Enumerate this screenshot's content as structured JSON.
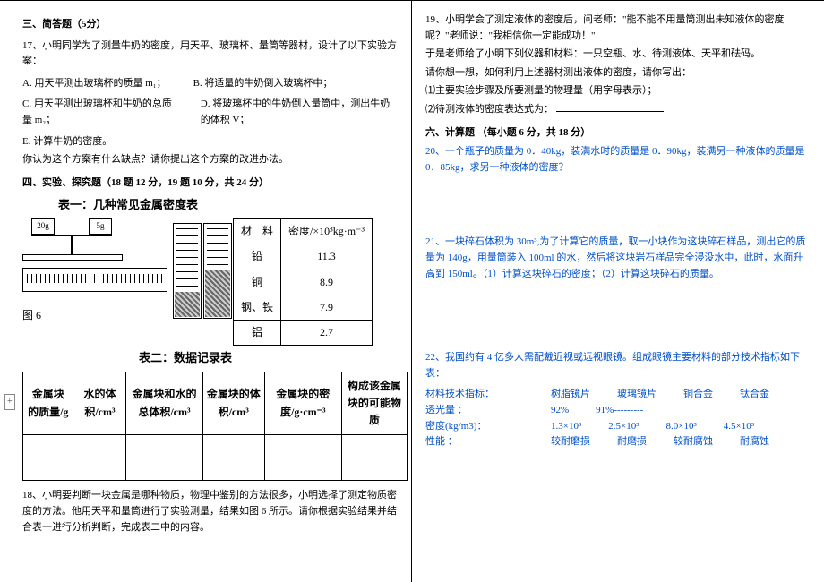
{
  "left": {
    "section3_title": "三、简答题（5分）",
    "q17_intro": "17、小明同学为了测量牛奶的密度，用天平、玻璃杯、量筒等器材，设计了以下实验方案：",
    "q17_A": "A. 用天平测出玻璃杯的质量 m₁；",
    "q17_B": "B. 将适量的牛奶倒入玻璃杯中；",
    "q17_C": "C. 用天平测出玻璃杯和牛奶的总质量 m₂；",
    "q17_D": "D. 将玻璃杯中的牛奶倒入量筒中，测出牛奶的体积 V；",
    "q17_E": "E. 计算牛奶的密度。",
    "q17_ask": "你认为这个方案有什么缺点？请你提出这个方案的改进办法。",
    "section4_title": "四、实验、探究题（18 题 12 分，19 题 10 分，共 24 分）",
    "table1_caption": "表一：几种常见金属密度表",
    "dens_header_mat": "材　料",
    "dens_header_rho": "密度/×10³kg·m⁻³",
    "dens_rows": [
      {
        "mat": "铅",
        "rho": "11.3"
      },
      {
        "mat": "铜",
        "rho": "8.9"
      },
      {
        "mat": "钢、铁",
        "rho": "7.9"
      },
      {
        "mat": "铝",
        "rho": "2.7"
      }
    ],
    "pan_left": "20g",
    "pan_right": "5g",
    "fig_label": "图 6",
    "table2_caption": "表二：数据记录表",
    "rec_headers": [
      "金属块的质量/g",
      "水的体积/cm³",
      "金属块和水的总体积/cm³",
      "金属块的体积/cm³",
      "金属块的密度/g·cm⁻³",
      "构成该金属块的可能物质"
    ],
    "q18": "18、小明要判断一块金属是哪种物质，物理中鉴别的方法很多，小明选择了测定物质密度的方法。他用天平和量筒进行了实验测量，结果如图 6 所示。请你根据实验结果并结合表一进行分析判断，完成表二中的内容。"
  },
  "right": {
    "q19_intro": "19、小明学会了测定液体的密度后，问老师：\"能不能不用量筒测出未知液体的密度呢？\"老师说：\"我相信你一定能成功！\"",
    "q19_given": "于是老师给了小明下列仪器和材料：一只空瓶、水、待测液体、天平和砝码。",
    "q19_ask": "请你想一想，如何利用上述器材测出液体的密度，请你写出：",
    "q19_sub1": "⑴主要实验步骤及所要测量的物理量（用字母表示）；",
    "q19_sub2_pre": "⑵待测液体的密度表达式为：",
    "section6_title": "六、计算题 （每小题 6 分，共 18 分）",
    "q20": "20、一个瓶子的质量为 0．40kg，装满水时的质量是 0．90kg，装满另一种液体的质量是 0．85kg，求另一种液体的密度？",
    "q21": "21、一块碎石体积为 30m³,为了计算它的质量，取一小块作为这块碎石样品，测出它的质量为 140g，用量筒装入 100ml 的水，然后将这块岩石样品完全浸没水中，此时，水面升高到 150ml。（1）计算这块碎石的密度；（2）计算这块碎石的质量。",
    "q22_intro": "22、我国约有 4 亿多人需配戴近视或远视眼镜。组成眼镜主要材料的部分技术指标如下表：",
    "spec_header": "材料技术指标：",
    "spec_cols": [
      "树脂镜片",
      "玻璃镜片",
      "铜合金",
      "钛合金"
    ],
    "spec_trans_label": "透光量 ：",
    "spec_trans": [
      "92%",
      "91%---------",
      "",
      ""
    ],
    "spec_dens_label": "密度(kg/m3)：",
    "spec_dens": [
      "1.3×10³",
      "2.5×10³",
      "8.0×10³",
      "4.5×10³"
    ],
    "spec_perf_label": "性能 ：",
    "spec_perf": [
      "较耐磨损",
      "耐磨损",
      "较耐腐蚀",
      "耐腐蚀"
    ]
  }
}
